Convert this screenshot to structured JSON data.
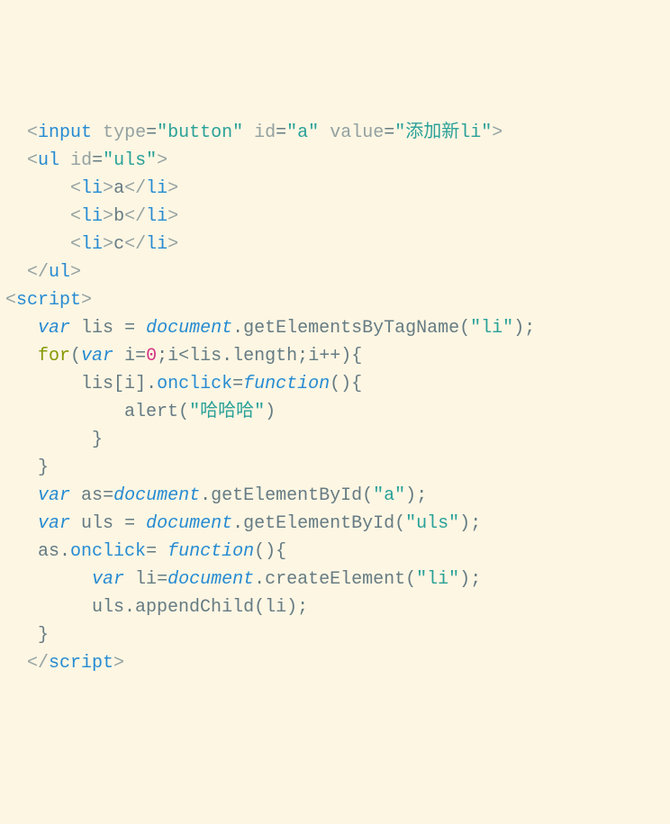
{
  "code": {
    "line1": {
      "tag_open_bracket": "<",
      "tag_input": "input",
      "attr_type_name": "type",
      "attr_type_eq": "=",
      "attr_type_val": "\"button\"",
      "attr_id_name": "id",
      "attr_id_eq": "=",
      "attr_id_val": "\"a\"",
      "attr_value_name": "value",
      "attr_value_eq": "=",
      "attr_value_val": "\"添加新li\"",
      "tag_close_bracket": ">"
    },
    "line2": {
      "tag_open_bracket": "<",
      "tag_ul": "ul",
      "attr_id_name": "id",
      "attr_id_eq": "=",
      "attr_id_val": "\"uls\"",
      "tag_close_bracket": ">"
    },
    "line3": {
      "open": "<",
      "li": "li",
      "close": ">",
      "text": "a",
      "open2": "</",
      "li2": "li",
      "close2": ">"
    },
    "line4": {
      "open": "<",
      "li": "li",
      "close": ">",
      "text": "b",
      "open2": "</",
      "li2": "li",
      "close2": ">"
    },
    "line5": {
      "open": "<",
      "li": "li",
      "close": ">",
      "text": "c",
      "open2": "</",
      "li2": "li",
      "close2": ">"
    },
    "line6": {
      "open": "</",
      "ul": "ul",
      "close": ">"
    },
    "line7": {
      "open": "<",
      "script": "script",
      "close": ">"
    },
    "line8": {
      "kw_var": "var",
      "sp": " ",
      "ident_lis": "lis",
      "eq": " = ",
      "document": "document",
      "dot": ".",
      "method": "getElementsByTagName",
      "lp": "(",
      "arg": "\"li\"",
      "rp": ")",
      "semi": ";"
    },
    "line9": {
      "kw_for": "for",
      "lp": "(",
      "kw_var": "var",
      "sp": " ",
      "ident_i": "i",
      "eq": "=",
      "zero": "0",
      "semi1": ";",
      "cond": "i<lis.length",
      "semi2": ";",
      "inc": "i++",
      "rp": ")",
      "brace": "{"
    },
    "line10": {
      "lis": "lis",
      "lb": "[",
      "i": "i",
      "rb": "]",
      "dot": ".",
      "onclick": "onclick",
      "eq": "=",
      "func": "function",
      "lp": "(",
      "rp": ")",
      "brace": "{"
    },
    "line11": {
      "alert": "alert",
      "lp": "(",
      "arg": "\"哈哈哈\"",
      "rp": ")"
    },
    "line12": {
      "brace": "}"
    },
    "line13": {
      "brace": "}"
    },
    "line14": {
      "kw_var": "var",
      "sp": " ",
      "ident": "as",
      "eq": "=",
      "document": "document",
      "dot": ".",
      "method": "getElementById",
      "lp": "(",
      "arg": "\"a\"",
      "rp": ")",
      "semi": ";"
    },
    "line15": {
      "kw_var": "var",
      "sp": " ",
      "ident": "uls",
      "eq": " = ",
      "document": "document",
      "dot": ".",
      "method": "getElementById",
      "lp": "(",
      "arg": "\"uls\"",
      "rp": ")",
      "semi": ";"
    },
    "line16": {
      "as": "as",
      "dot": ".",
      "onclick": "onclick",
      "eq": "= ",
      "func": "function",
      "lp": "(",
      "rp": ")",
      "brace": "{"
    },
    "line17": {
      "kw_var": "var",
      "sp": " ",
      "ident": "li",
      "eq": "=",
      "document": "document",
      "dot": ".",
      "method": "createElement",
      "lp": "(",
      "arg": "\"li\"",
      "rp": ")",
      "semi": ";"
    },
    "line18": {
      "uls": "uls",
      "dot": ".",
      "method": "appendChild",
      "lp": "(",
      "arg": "li",
      "rp": ")",
      "semi": ";"
    },
    "line19": {
      "brace": "}"
    },
    "line20": {
      "open": "</",
      "script": "script",
      "close": ">"
    }
  }
}
